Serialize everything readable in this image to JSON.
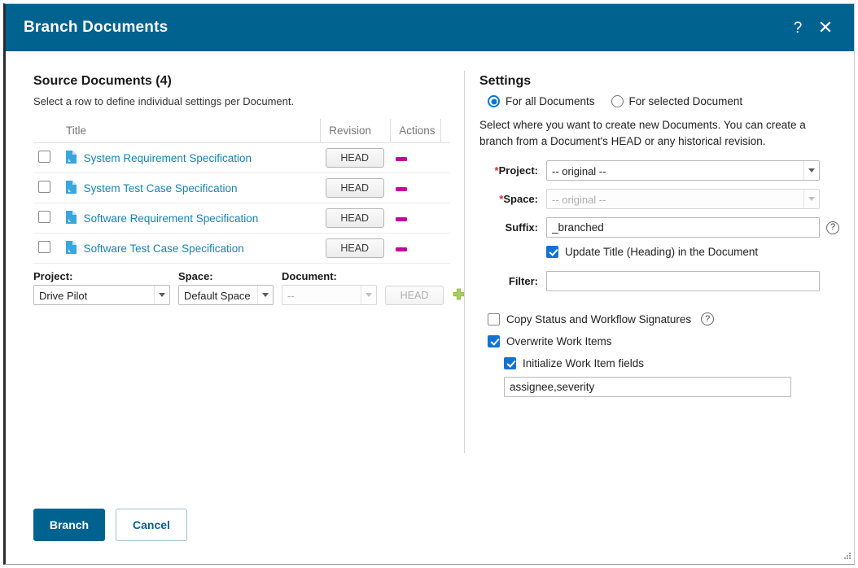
{
  "window": {
    "title": "Branch Documents",
    "help_icon": "question-mark-icon",
    "close_icon": "close-icon",
    "accent_color": "#00628e",
    "link_color": "#1a82b4",
    "remove_color": "#c5009b",
    "add_color": "#a8ce5e",
    "checked_color": "#1272d4"
  },
  "source": {
    "heading": "Source Documents (4)",
    "hint": "Select a row to define individual settings per Document.",
    "columns": {
      "title": "Title",
      "revision": "Revision",
      "actions": "Actions"
    },
    "rows": [
      {
        "title": "System Requirement Specification",
        "revision": "HEAD",
        "checked": false
      },
      {
        "title": "System Test Case Specification",
        "revision": "HEAD",
        "checked": false
      },
      {
        "title": "Software Requirement Specification",
        "revision": "HEAD",
        "checked": false
      },
      {
        "title": "Software Test Case Specification",
        "revision": "HEAD",
        "checked": false
      }
    ],
    "add": {
      "project_label": "Project:",
      "project_value": "Drive Pilot",
      "space_label": "Space:",
      "space_value": "Default Space",
      "document_label": "Document:",
      "document_value": "--",
      "revision_value": "HEAD",
      "add_icon": "plus-icon"
    }
  },
  "settings": {
    "heading": "Settings",
    "scope": {
      "all_label": "For all Documents",
      "selected_label": "For selected Document",
      "selected": "all"
    },
    "description": "Select where you want to create new Documents. You can create a branch from a Document's HEAD or any historical revision.",
    "project": {
      "label": "Project:",
      "required": true,
      "value": "-- original --",
      "disabled": false
    },
    "space": {
      "label": "Space:",
      "required": true,
      "value": "-- original --",
      "disabled": true
    },
    "suffix": {
      "label": "Suffix:",
      "value": "_branched",
      "help_icon": "help-circle-icon"
    },
    "update_title": {
      "label": "Update Title (Heading) in the Document",
      "checked": true
    },
    "filter": {
      "label": "Filter:",
      "value": "",
      "placeholder": ""
    },
    "copy_status": {
      "label": "Copy Status and Workflow Signatures",
      "checked": false,
      "help_icon": "help-circle-icon"
    },
    "overwrite": {
      "label": "Overwrite Work Items",
      "checked": true
    },
    "initialize": {
      "label": "Initialize Work Item fields",
      "checked": true
    },
    "initialize_fields": {
      "value": "assignee,severity",
      "placeholder": ""
    }
  },
  "footer": {
    "primary": "Branch",
    "secondary": "Cancel"
  }
}
